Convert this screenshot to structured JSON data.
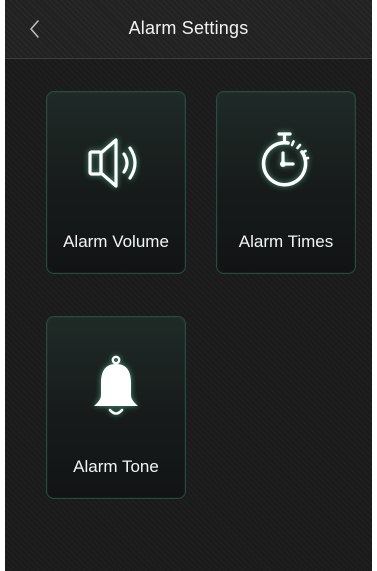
{
  "header": {
    "title": "Alarm Settings",
    "back_icon": "chevron-left-icon"
  },
  "tiles": [
    {
      "label": "Alarm Volume",
      "icon": "speaker-icon"
    },
    {
      "label": "Alarm Times",
      "icon": "stopwatch-icon"
    },
    {
      "label": "Alarm Tone",
      "icon": "bell-icon"
    }
  ],
  "colors": {
    "background": "#1b1b1b",
    "tile_border": "#1f4e42",
    "icon": "#ffffff",
    "icon_glow": "#78ffc8",
    "text": "#f4f4f4"
  }
}
